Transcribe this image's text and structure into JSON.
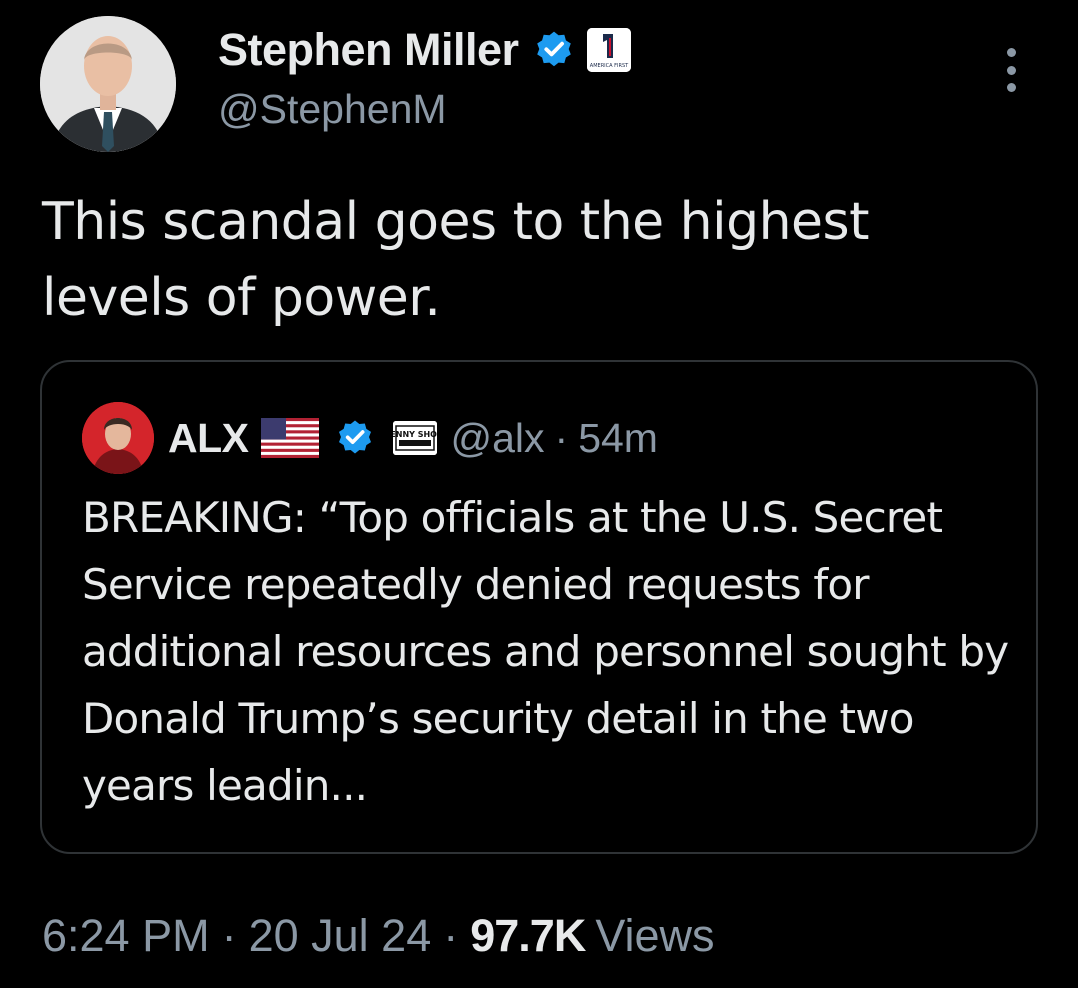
{
  "tweet": {
    "author": {
      "display_name": "Stephen Miller",
      "handle": "@StephenM",
      "avatar_icon": "profile-photo-man-in-suit",
      "verified_icon": "verified-badge-icon",
      "affiliate_badge_label": "AMERICA FIRST"
    },
    "more_icon": "more-options-icon",
    "text": "This scandal goes to the highest levels of power.",
    "quoted": {
      "display_name": "ALX",
      "flag_icon": "us-flag-icon",
      "verified_icon": "verified-badge-icon",
      "affiliate_badge_label": "BENNY SHOW",
      "handle": "@alx",
      "separator": "·",
      "time": "54m",
      "text": "BREAKING: “Top officials at the U.S. Secret Service repeatedly denied requests for additional resources and personnel sought by Donald Trump’s security detail in the two years leadin..."
    },
    "meta": {
      "time": "6:24 PM",
      "separator": "·",
      "date": "20 Jul 24",
      "views_count": "97.7K",
      "views_label": "Views"
    }
  },
  "colors": {
    "background": "#000000",
    "text_primary": "#e7e9ea",
    "text_secondary": "#8b98a5",
    "border": "#2f3336",
    "verified_blue": "#1d9bf0"
  }
}
